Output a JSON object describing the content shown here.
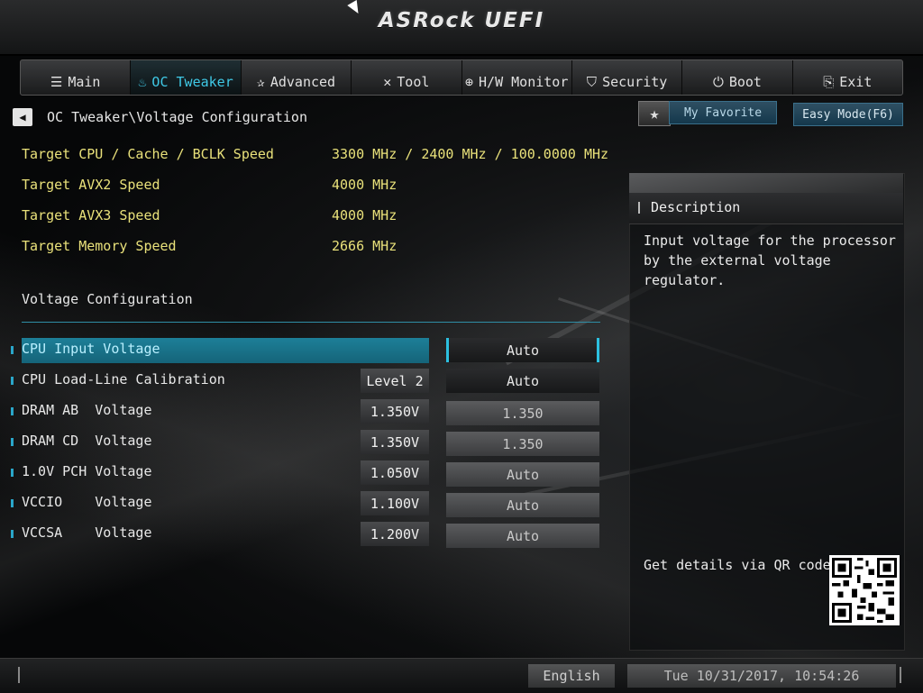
{
  "header": {
    "logo": "ASRock UEFI"
  },
  "tabs": [
    {
      "label": "Main",
      "icon": "list-icon",
      "active": false
    },
    {
      "label": "OC Tweaker",
      "icon": "flame-icon",
      "active": true
    },
    {
      "label": "Advanced",
      "icon": "star-icon",
      "active": false
    },
    {
      "label": "Tool",
      "icon": "tools-icon",
      "active": false
    },
    {
      "label": "H/W Monitor",
      "icon": "monitor-icon",
      "active": false
    },
    {
      "label": "Security",
      "icon": "shield-icon",
      "active": false
    },
    {
      "label": "Boot",
      "icon": "power-icon",
      "active": false
    },
    {
      "label": "Exit",
      "icon": "exit-icon",
      "active": false
    }
  ],
  "breadcrumb": "OC Tweaker\\Voltage Configuration",
  "favorite": {
    "label": "My Favorite"
  },
  "easy_mode": {
    "label": "Easy Mode(F6)"
  },
  "info": [
    {
      "label": "Target CPU / Cache / BCLK Speed",
      "value": "3300 MHz / 2400 MHz / 100.0000 MHz"
    },
    {
      "label": "Target AVX2 Speed",
      "value": "4000 MHz"
    },
    {
      "label": "Target AVX3 Speed",
      "value": "4000 MHz"
    },
    {
      "label": "Target Memory Speed",
      "value": "2666 MHz"
    }
  ],
  "section_title": "Voltage Configuration",
  "settings": [
    {
      "label": "CPU Input Voltage",
      "current": "",
      "value": "Auto"
    },
    {
      "label": "CPU Load-Line Calibration",
      "current": "Level 2",
      "value": "Auto"
    },
    {
      "label": "DRAM AB  Voltage",
      "current": "1.350V",
      "value": "1.350"
    },
    {
      "label": "DRAM CD  Voltage",
      "current": "1.350V",
      "value": "1.350"
    },
    {
      "label": "1.0V PCH Voltage",
      "current": "1.050V",
      "value": "Auto"
    },
    {
      "label": "VCCIO    Voltage",
      "current": "1.100V",
      "value": "Auto"
    },
    {
      "label": "VCCSA    Voltage",
      "current": "1.200V",
      "value": "Auto"
    }
  ],
  "description": {
    "title": "Description",
    "text": "Input voltage for the processor by the external voltage regulator.",
    "qr_label": "Get details via QR code"
  },
  "footer": {
    "language": "English",
    "datetime": "Tue 10/31/2017, 10:54:26"
  },
  "colors": {
    "accent": "#2aa6c9",
    "info_text": "#e9e17a",
    "highlight": "#1d7f98"
  }
}
